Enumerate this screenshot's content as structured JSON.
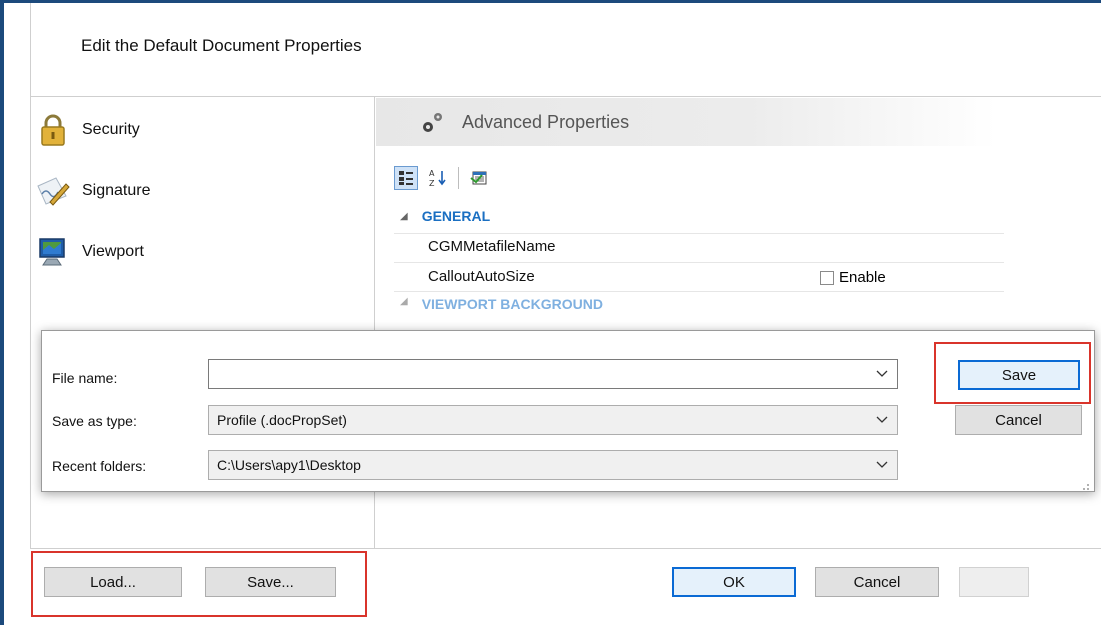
{
  "dialog": {
    "title": "Edit the Default Document Properties"
  },
  "nav": {
    "items": [
      {
        "label": "Security",
        "icon": "lock-icon"
      },
      {
        "label": "Signature",
        "icon": "signature-icon"
      },
      {
        "label": "Viewport",
        "icon": "monitor-icon"
      }
    ]
  },
  "properties": {
    "header": "Advanced Properties",
    "toolbar": [
      "categorized-icon",
      "alphabetical-icon",
      "property-pages-icon"
    ],
    "categories": [
      {
        "name": "GENERAL",
        "rows": [
          {
            "name": "CGMMetafileName",
            "value": ""
          },
          {
            "name": "CalloutAutoSize",
            "value_label": "Enable",
            "checked": false
          }
        ]
      },
      {
        "name": "VIEWPORT BACKGROUND",
        "rows": []
      }
    ]
  },
  "save_dialog": {
    "file_name": {
      "label": "File name:",
      "value": ""
    },
    "save_as_type": {
      "label": "Save as type:",
      "value": "Profile (.docPropSet)"
    },
    "recent_folders": {
      "label": "Recent folders:",
      "value": "C:\\Users\\apy1\\Desktop"
    },
    "save_label": "Save",
    "cancel_label": "Cancel"
  },
  "footer": {
    "load_label": "Load...",
    "save_label": "Save...",
    "ok_label": "OK",
    "cancel_label": "Cancel"
  },
  "colors": {
    "frame": "#1c4a7c",
    "category_text": "#1a6fc2",
    "highlight": "#d9342b",
    "default_button_border": "#0a6ad4"
  }
}
